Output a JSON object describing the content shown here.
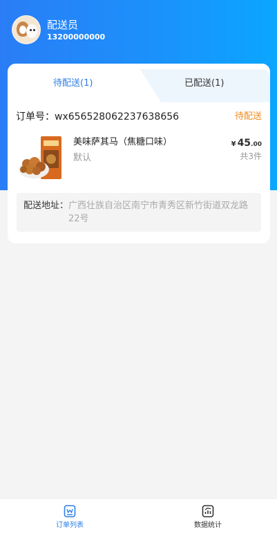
{
  "user": {
    "name": "配送员",
    "phone": "13200000000"
  },
  "tabs": [
    {
      "label": "待配送(1)",
      "active": true
    },
    {
      "label": "已配送(1)",
      "active": false
    }
  ],
  "order": {
    "number": "订单号：wx656528062237638656",
    "status": "待配送",
    "product": {
      "name": "美味萨其马（焦糖口味）",
      "spec": "默认",
      "price_symbol": "¥",
      "price_int": "45",
      "price_dec": ".00",
      "quantity": "共3件"
    },
    "address": {
      "label": "配送地址：",
      "value": "广西壮族自治区南宁市青秀区新竹街道双龙路22号"
    }
  },
  "nav": {
    "orders_label": "订单列表",
    "stats_label": "数据统计"
  },
  "colors": {
    "accent": "#2b7ee8",
    "status_pending": "#f28a1e"
  }
}
